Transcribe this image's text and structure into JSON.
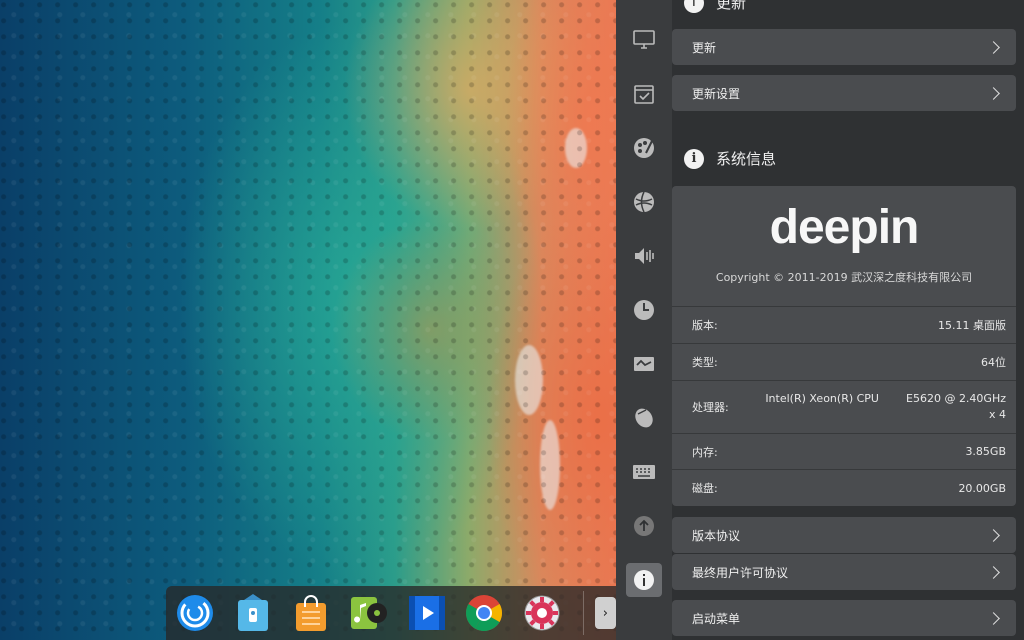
{
  "dock": {
    "apps": [
      {
        "name": "launcher",
        "icon": "deepin-launcher-icon"
      },
      {
        "name": "file-manager",
        "icon": "file-manager-icon"
      },
      {
        "name": "app-store",
        "icon": "app-store-icon"
      },
      {
        "name": "music",
        "icon": "music-player-icon"
      },
      {
        "name": "movie",
        "icon": "movie-player-icon"
      },
      {
        "name": "chrome",
        "icon": "chrome-icon"
      },
      {
        "name": "control-center",
        "icon": "settings-gear-icon"
      }
    ],
    "expand_label": "›"
  },
  "nav": {
    "items": [
      {
        "id": "display",
        "icon": "monitor-icon"
      },
      {
        "id": "default-apps",
        "icon": "calendar-check-icon"
      },
      {
        "id": "personalization",
        "icon": "palette-icon"
      },
      {
        "id": "network",
        "icon": "network-icon"
      },
      {
        "id": "sound",
        "icon": "speaker-icon"
      },
      {
        "id": "time",
        "icon": "clock-icon"
      },
      {
        "id": "power",
        "icon": "battery-icon"
      },
      {
        "id": "mouse",
        "icon": "mouse-icon"
      },
      {
        "id": "keyboard",
        "icon": "keyboard-icon"
      },
      {
        "id": "update",
        "icon": "update-arrow-icon"
      },
      {
        "id": "system-info",
        "icon": "info-icon",
        "active": true
      }
    ]
  },
  "update_section": {
    "title": "更新",
    "items": [
      {
        "label": "更新"
      },
      {
        "label": "更新设置"
      }
    ]
  },
  "system_info": {
    "title": "系统信息",
    "brand": "deepin",
    "copyright": "Copyright © 2011-2019 武汉深之度科技有限公司",
    "rows": {
      "edition": {
        "key": "版本:",
        "value": "15.11 桌面版"
      },
      "type": {
        "key": "类型:",
        "value": "64位"
      },
      "cpu": {
        "key": "处理器:",
        "value_part1": "Intel(R) Xeon(R) CPU",
        "value_part2": "E5620 @ 2.40GHz",
        "value_part3": "x 4"
      },
      "memory": {
        "key": "内存:",
        "value": "3.85GB"
      },
      "disk": {
        "key": "磁盘:",
        "value": "20.00GB"
      }
    }
  },
  "links": [
    {
      "label": "版本协议"
    },
    {
      "label": "最终用户许可协议"
    },
    {
      "label": "启动菜单"
    }
  ],
  "colors": {
    "panel_bg": "#2f3133",
    "nav_bg": "#3a3c3e",
    "row_bg": "#4a4c4f",
    "active_nav": "#6b6d70"
  }
}
